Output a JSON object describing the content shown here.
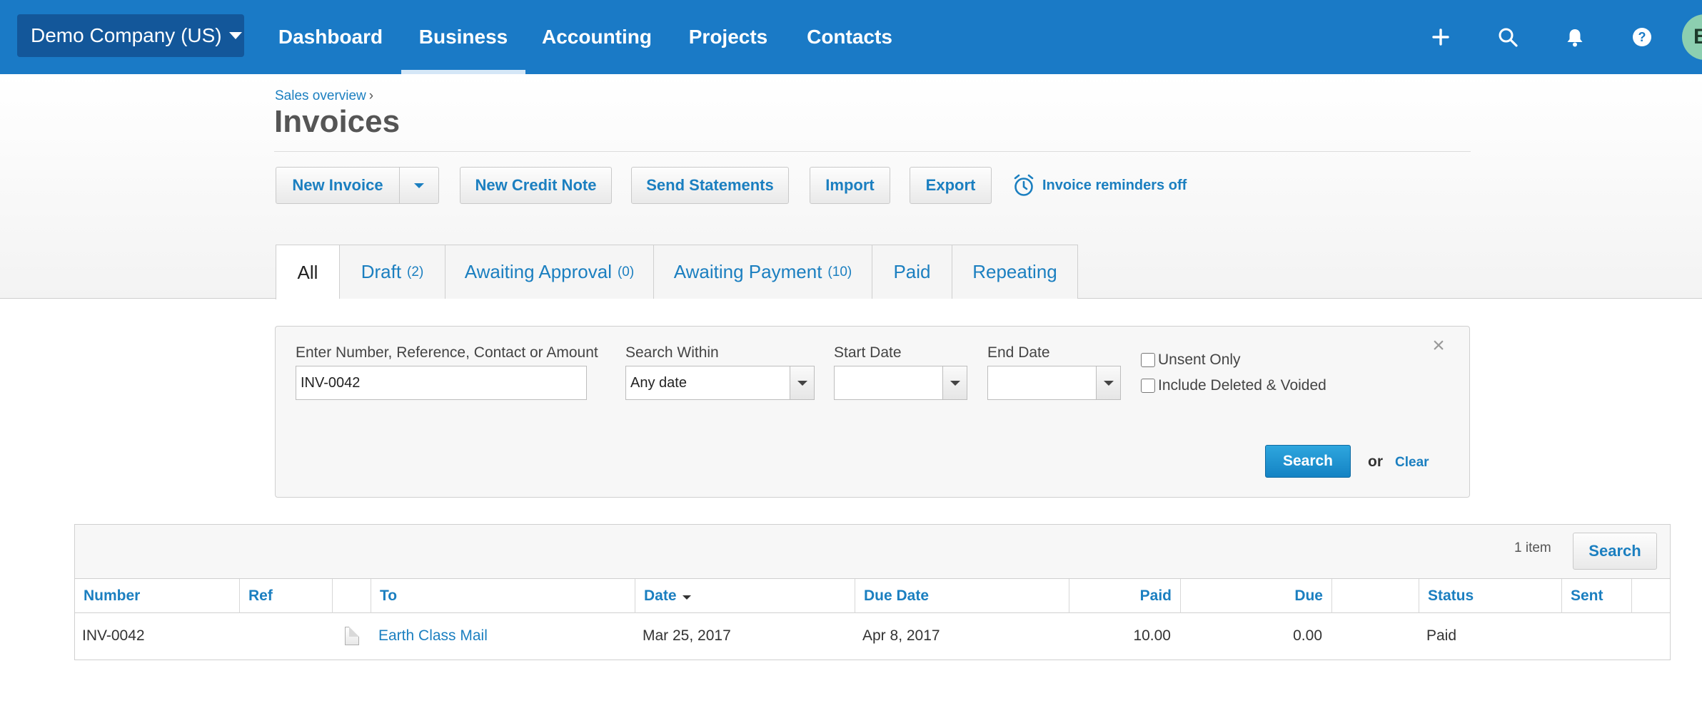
{
  "topbar": {
    "org_name": "Demo Company (US)",
    "nav": [
      {
        "label": "Dashboard"
      },
      {
        "label": "Business"
      },
      {
        "label": "Accounting"
      },
      {
        "label": "Projects"
      },
      {
        "label": "Contacts"
      }
    ],
    "active_nav": "Business",
    "icons": [
      "plus-icon",
      "search-icon",
      "bell-icon",
      "help-icon"
    ],
    "avatar_initial": "B"
  },
  "header": {
    "breadcrumb": "Sales overview",
    "breadcrumb_sep": "›",
    "title": "Invoices"
  },
  "toolbar": {
    "new_invoice": "New Invoice",
    "new_credit_note": "New Credit Note",
    "send_statements": "Send Statements",
    "import": "Import",
    "export": "Export",
    "reminders": "Invoice reminders off"
  },
  "tabs": [
    {
      "label": "All",
      "count": ""
    },
    {
      "label": "Draft",
      "count": "(2)"
    },
    {
      "label": "Awaiting Approval",
      "count": "(0)"
    },
    {
      "label": "Awaiting Payment",
      "count": "(10)"
    },
    {
      "label": "Paid",
      "count": ""
    },
    {
      "label": "Repeating",
      "count": ""
    }
  ],
  "search": {
    "query_label": "Enter Number, Reference, Contact or Amount",
    "query_value": "INV-0042",
    "within_label": "Search Within",
    "within_value": "Any date",
    "start_label": "Start Date",
    "start_value": "",
    "end_label": "End Date",
    "end_value": "",
    "unsent_only": "Unsent Only",
    "include_deleted": "Include Deleted & Voided",
    "search_button": "Search",
    "or": "or",
    "clear": "Clear"
  },
  "results": {
    "count": "1 item",
    "search_button": "Search",
    "columns": [
      "Number",
      "Ref",
      "",
      "To",
      "Date",
      "Due Date",
      "Paid",
      "Due",
      "",
      "Status",
      "Sent"
    ],
    "rows": [
      {
        "number": "INV-0042",
        "ref": "",
        "to": "Earth Class Mail",
        "date": "Mar 25, 2017",
        "due_date": "Apr 8, 2017",
        "paid": "10.00",
        "due": "0.00",
        "status": "Paid",
        "sent": ""
      }
    ]
  },
  "colors": {
    "topbar": "#1a7ac6",
    "org_switch": "#13579a",
    "link": "#1b7fc0",
    "primary_button": "#1483c4"
  }
}
